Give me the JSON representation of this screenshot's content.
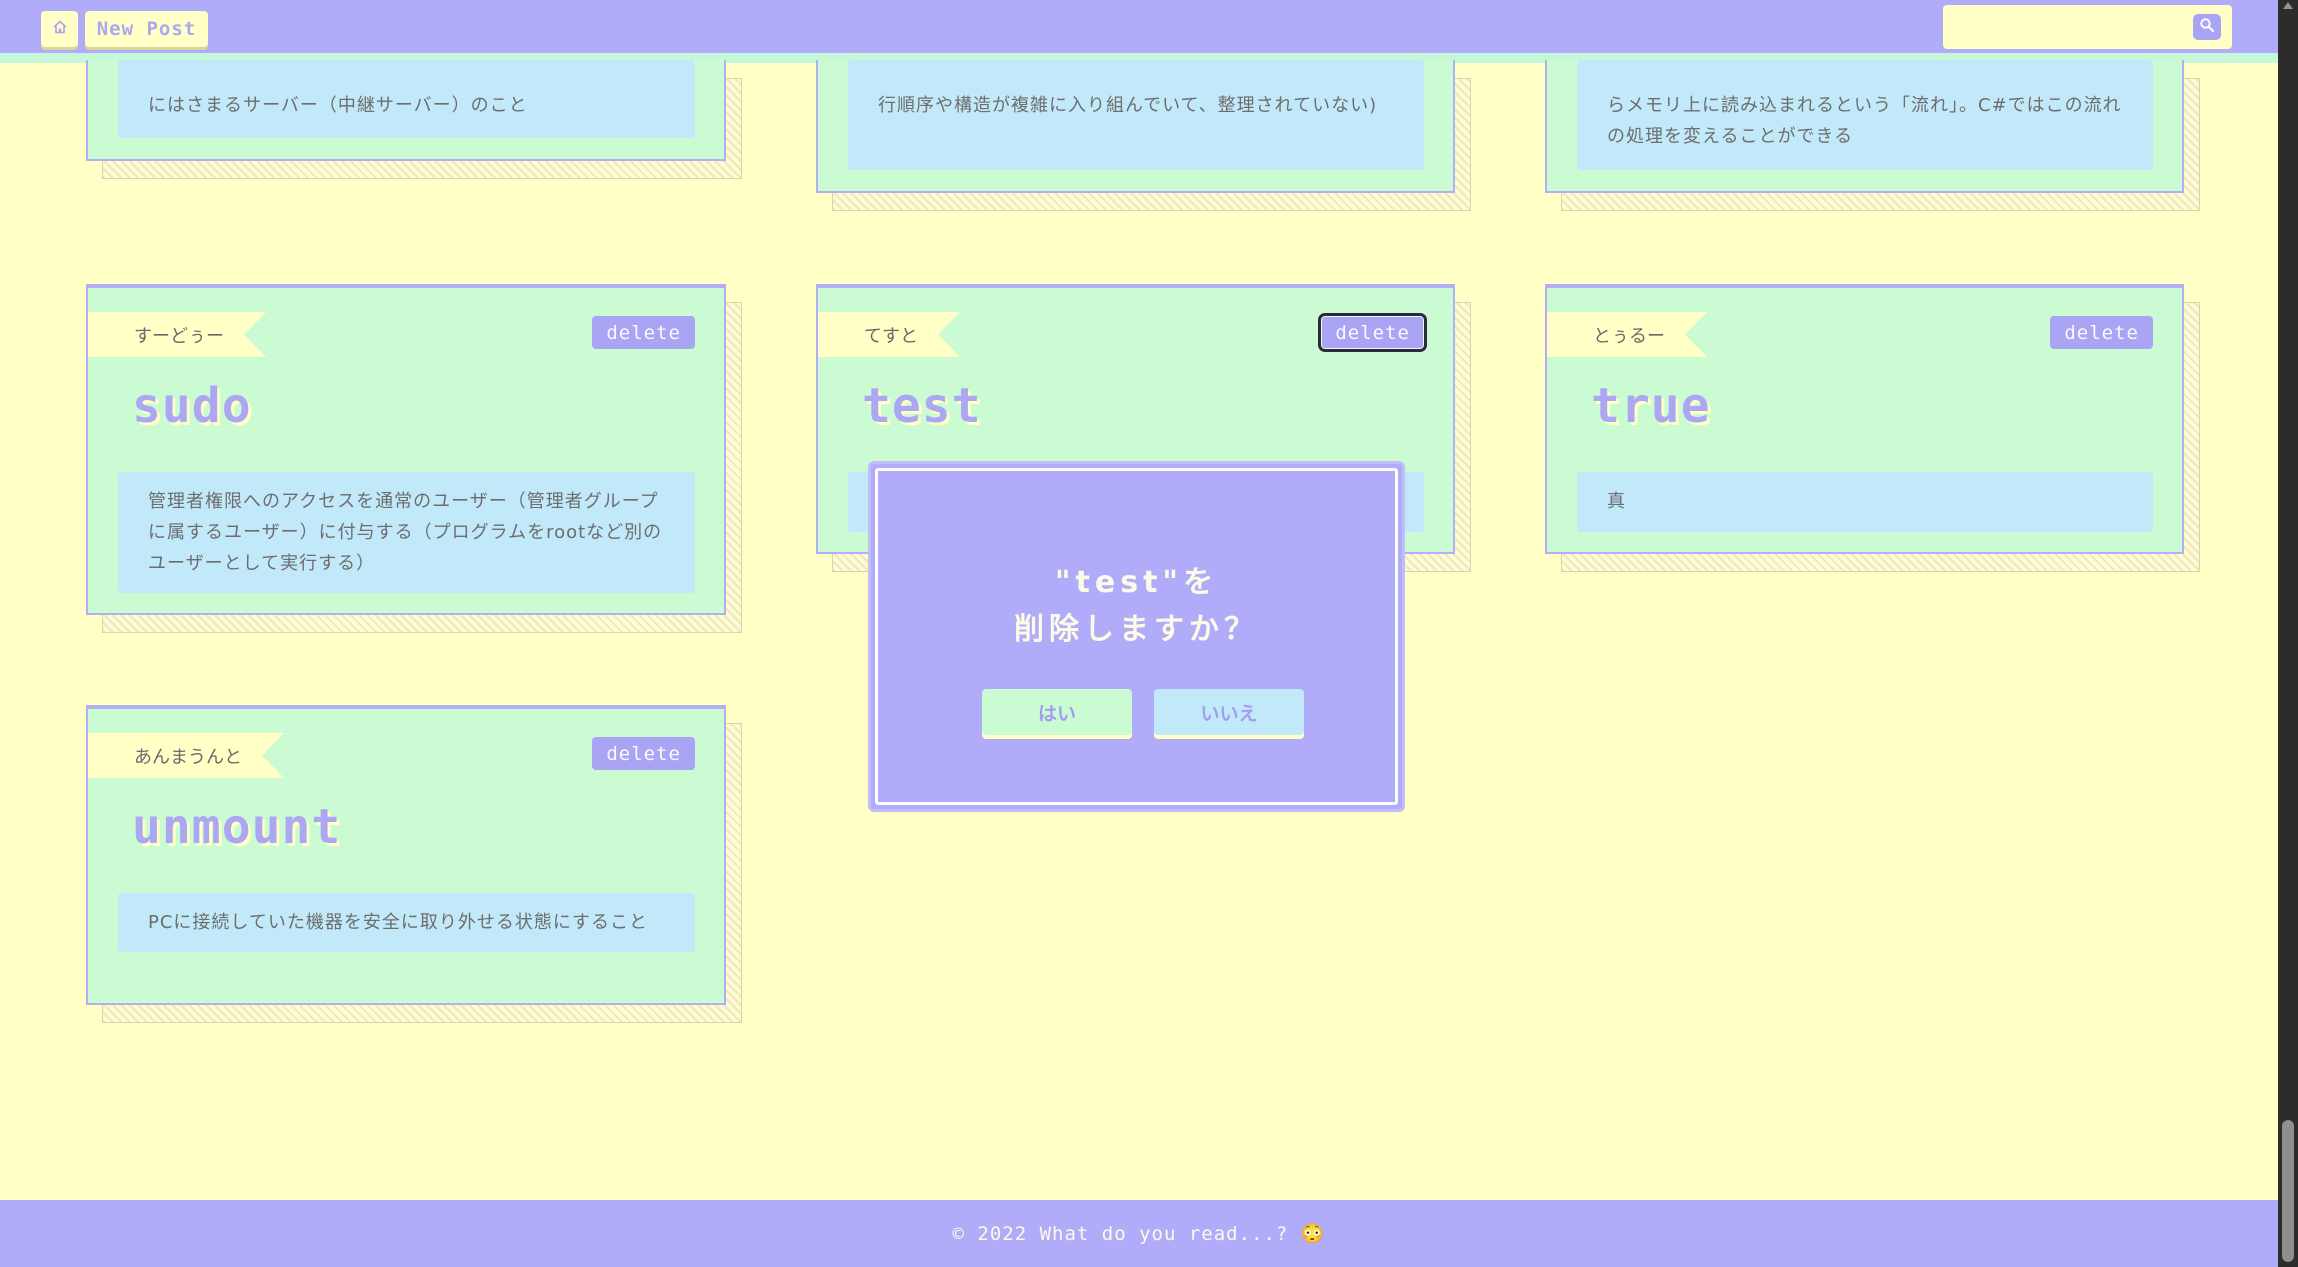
{
  "header": {
    "home_icon": "home-icon",
    "new_post_label": "New Post",
    "search_placeholder": "",
    "search_icon": "search-icon"
  },
  "top_cards": [
    {
      "description": "にはさまるサーバー（中継サーバー）のこと"
    },
    {
      "description": "行順序や構造が複雑に入り組んでいて、整理されていない)"
    },
    {
      "description": "らメモリ上に読み込まれるという「流れ」。C#ではこの流れの処理を変えることができる"
    }
  ],
  "cards": [
    {
      "reading": "すーどぅー",
      "delete_label": "delete",
      "title": "sudo",
      "description": "管理者権限へのアクセスを通常のユーザー（管理者グループに属するユーザー）に付与する（プログラムをrootなど別のユーザーとして実行する）"
    },
    {
      "reading": "てすと",
      "delete_label": "delete",
      "title": "test",
      "description": ""
    },
    {
      "reading": "とぅるー",
      "delete_label": "delete",
      "title": "true",
      "description": "真"
    },
    {
      "reading": "あんまうんと",
      "delete_label": "delete",
      "title": "unmount",
      "description": "PCに接続していた機器を安全に取り外せる状態にすること"
    }
  ],
  "modal": {
    "line1": "\"test\"を",
    "line2": "削除しますか？",
    "yes_label": "はい",
    "no_label": "いいえ"
  },
  "footer": {
    "text": "© 2022 What do you read...? 😳"
  },
  "colors": {
    "background": "#ffffc6",
    "header": "#b1acf9",
    "card": "#cbfbd3",
    "card_desc": "#c2e9fa",
    "accent": "#a9a4f4"
  }
}
